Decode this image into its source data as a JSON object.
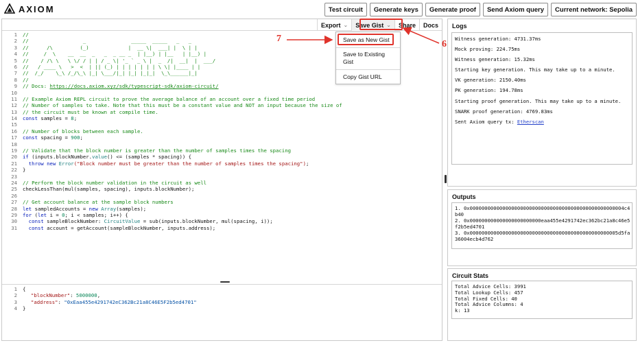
{
  "app": {
    "brand": "AXIOM"
  },
  "toolbar": {
    "buttons": [
      "Test circuit",
      "Generate keys",
      "Generate proof",
      "Send Axiom query",
      "Current network: Sepolia"
    ]
  },
  "editor_toolbar": {
    "export": "Export",
    "save_gist": "Save Gist",
    "share": "Share",
    "docs": "Docs"
  },
  "dropdown": {
    "save_new": "Save as New Gist",
    "save_existing_1": "Save to Existing",
    "save_existing_2": "Gist",
    "copy_url": "Copy Gist URL"
  },
  "annotations": {
    "label_7": "7",
    "label_6": "6"
  },
  "code_lines": [
    "1",
    "2",
    "3",
    "4",
    "5",
    "6",
    "7",
    "8",
    "9",
    "10",
    "11",
    "12",
    "13",
    "14",
    "15",
    "16",
    "17",
    "18",
    "19",
    "20",
    "21",
    "22",
    "23",
    "24",
    "25",
    "26",
    "27",
    "28",
    "29",
    "30",
    "31"
  ],
  "code": {
    "l1": "//",
    "l2": "//                  _               _____  _____   _   _",
    "l3": "//      /\\         (_)             |  __ \\|  ___| |  \\ | |",
    "l4": "//     /  \\    __  __  _   _  _ __ _  | |__) | |__   | |__) |",
    "l5": "//    / /\\ \\   \\ \\/ / | | / _ \\| '_ ` _ \\ |  _  /|  __|  |  ___/",
    "l6": "//   / ____ \\   >  <  | || (_) | | | | | | | \\ \\| |____ | |",
    "l7": "//  /_/    \\_\\ /_/\\_\\ |_| \\___/|_| |_| |_|_|  \\_\\______|_|",
    "l8": "//",
    "l9_prefix": "// Docs: ",
    "l9_link": "https://docs.axiom.xyz/sdk/typescript-sdk/axiom-circuit/",
    "l10": "",
    "l11": "// Example Axiom REPL circuit to prove the average balance of an account over a fixed time period",
    "l12": "// Number of samples to take. Note that this must be a constant value and NOT an input because the size of",
    "l13": "// the circuit must be known at compile time.",
    "l14_kw": "const",
    "l14_rest": " samples = ",
    "l14_num": "8",
    "l14_end": ";",
    "l15": "",
    "l16": "// Number of blocks between each sample.",
    "l17_kw": "const",
    "l17_rest": " spacing = ",
    "l17_num": "900",
    "l17_end": ";",
    "l18": "",
    "l19": "// Validate that the block number is greater than the number of samples times the spacing",
    "l20_kw": "if",
    "l20_rest": " (inputs.blockNumber.",
    "l20_fn": "value",
    "l20_end": "() <= (samples * spacing)) {",
    "l21_kw1": "  throw",
    "l21_kw2": " new ",
    "l21_type": "Error",
    "l21_str": "(\"Block number must be greater than the number of samples times the spacing\")",
    "l21_end": ";",
    "l22": "}",
    "l23": "",
    "l24": "// Perform the block number validation in the circuit as well",
    "l25": "checkLessThan(mul(samples, spacing), inputs.blockNumber);",
    "l26": "",
    "l27": "// Get account balance at the sample block numbers",
    "l28_kw": "let",
    "l28_rest": " sampledAccounts = ",
    "l28_kw2": "new",
    "l28_type": " Array",
    "l28_end": "(samples);",
    "l29_kw": "for",
    "l29_a": " (",
    "l29_kw2": "let",
    "l29_b": " i = ",
    "l29_num": "0",
    "l29_c": "; i < samples; i++) {",
    "l30_kw": "  const",
    "l30_a": " sampleBlockNumber: ",
    "l30_type": "CircuitValue",
    "l30_b": " = sub(inputs.blockNumber, mul(spacing, i));",
    "l31_kw": "  const",
    "l31_a": " account = getAccount(sampleBlockNumber, inputs.address);"
  },
  "json_lines": [
    "1",
    "2",
    "3",
    "4"
  ],
  "json": {
    "j1": "{",
    "j2_key": "\"blockNumber\"",
    "j2_sep": ": ",
    "j2_val": "5000000",
    "j2_end": ",",
    "j3_key": "\"address\"",
    "j3_sep": ": ",
    "j3_val": "\"0xEaa455e4291742eC362Bc21a8C46E5F2b5ed4701\"",
    "j4": "}"
  },
  "logs": {
    "title": "Logs",
    "lines": [
      "Witness generation: 4731.37ms",
      "Mock proving: 224.75ms",
      "Witness generation: 15.32ms",
      "Starting key generation. This may take up to a minute.",
      "VK generation: 2150.40ms",
      "PK generation: 194.78ms",
      "Starting proof generation. This may take up to a minute.",
      "SNARK proof generation: 4769.83ms"
    ],
    "last_prefix": "Sent Axiom query tx: ",
    "last_link": "Etherscan"
  },
  "outputs": {
    "title": "Outputs",
    "lines": [
      "1. 0x0000000000000000000000000000000000000000000000000004c4b40",
      "2. 0x000000000000000000000000eaa455e4291742ec362bc21a8c46e5f2b5ed4701",
      "3. 0x00000000000000000000000000000000000000000000000005d5fa36004ecb4d762"
    ]
  },
  "stats": {
    "title": "Circuit Stats",
    "lines": [
      "Total Advice Cells: 3991",
      "Total Lookup Cells: 457",
      "Total Fixed Cells: 40",
      "Total Advice Columns: 4",
      "k: 13"
    ]
  },
  "colors": {
    "annotation": "#e0332b",
    "comment": "#198a19",
    "keyword": "#0019b8",
    "link": "#2340c9"
  }
}
